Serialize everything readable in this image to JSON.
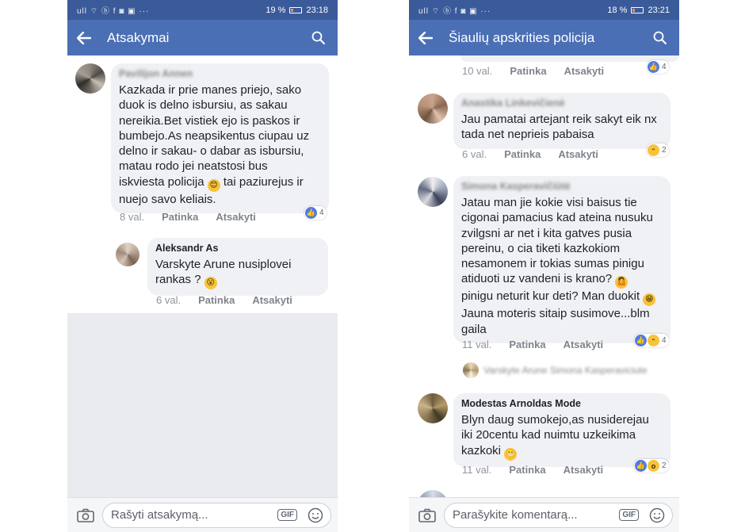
{
  "left": {
    "status": {
      "icons": "ull ⌔ ⓑ f ◙ ▣ ···",
      "battery": "19 %",
      "battery_level": 0.19,
      "time": "23:18"
    },
    "header": {
      "title": "Atsakymai"
    },
    "comments": [
      {
        "author": "Pavilijon Annen",
        "text": "Kazkada ir prie manes priejo, sako\nduok is delno isbursiu, as sakau\nnereikia.Bet vistiek ejo is paskos ir\nbumbejo.As neapsikentus ciupau uz\ndelno ir sakau- o dabar as isbursiu,\nmatau rodo jei neatstosi bus\niskviesta policija",
        "emoji": "😊",
        "text_after": " tai paziurejus ir\nnuejo savo keliais.",
        "time": "8 val.",
        "like": "Patinka",
        "reply": "Atsakyti",
        "reaction_count": "4"
      },
      {
        "author": "Aleksandr As",
        "text": "Varskyte Arune nusiplovei\nrankas ?",
        "emoji": "😮",
        "time": "6 val.",
        "like": "Patinka",
        "reply": "Atsakyti"
      }
    ],
    "composer": {
      "placeholder": "Rašyti atsakymą...",
      "gif": "GIF"
    }
  },
  "right": {
    "status": {
      "icons": "ull ⌔ ⓑ f ◙ ▣ ···",
      "battery": "18 %",
      "battery_level": 0.18,
      "time": "23:21"
    },
    "header": {
      "title": "Šiaulių apskrities policija"
    },
    "top_meta": {
      "time": "10 val.",
      "like": "Patinka",
      "reply": "Atsakyti",
      "reaction_count": "4"
    },
    "comments": [
      {
        "author": "Anastika Linkevičienė",
        "text": "Jau pamatai artejant reik sakyt eik nx\ntada net neprieis pabaisa",
        "time": "6 val.",
        "like": "Patinka",
        "reply": "Atsakyti",
        "reaction_count": "2"
      },
      {
        "author": "Simona Kasperavičiūtė",
        "text": "Jatau man jie kokie visi baisus tie\ncigonai pamacius kad ateina nusuku\nzvilgsni ar net i kita gatves pusia\npereinu, o cia tiketi kazkokiom\nnesamonem ir tokias sumas pinigu\natiduoti uz vandeni is krano?",
        "emoji1": "🤷",
        "text_mid": "\npinigu neturit kur deti? Man duokit",
        "emoji2": "😁",
        "text_after": "\nJauna moteris sitaip susimove...blm\ngaila",
        "time": "11 val.",
        "like": "Patinka",
        "reply": "Atsakyti",
        "reaction_count": "4"
      },
      {
        "author": "Modestas Arnoldas Mode",
        "text": "Blyn daug sumokejo,as nusiderejau\niki 20centu kad nuimtu uzkeikima\nkazkoki",
        "emoji": "😬",
        "time": "11 val.",
        "like": "Patinka",
        "reply": "Atsakyti",
        "reaction_count": "2"
      }
    ],
    "collapsed_reply": "Varskyte Arune Simona Kasperaviciute",
    "composer": {
      "placeholder": "Parašykite komentarą...",
      "gif": "GIF"
    }
  },
  "icons": {
    "back": "arrow-left-icon",
    "search": "search-icon",
    "camera": "camera-icon",
    "gif": "gif-icon",
    "emoji": "smiley-icon",
    "like": "like-icon",
    "haha": "haha-icon",
    "wow": "wow-icon"
  },
  "colors": {
    "status_bar": "#3b5a9a",
    "app_bar": "#4a6fb5",
    "bubble": "#f0f1f4",
    "grey_area": "#e9ebee",
    "like_blue": "#4f7ce3"
  }
}
